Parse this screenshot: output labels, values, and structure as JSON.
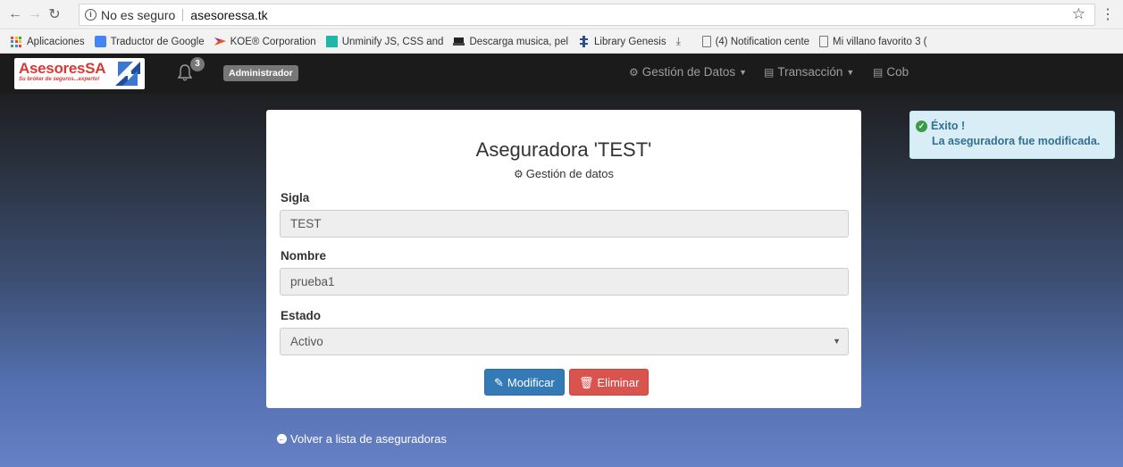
{
  "browser": {
    "security_label": "No es seguro",
    "url": "asesoressa.tk",
    "bookmarks": [
      {
        "label": "Aplicaciones",
        "icon": "apps-icon"
      },
      {
        "label": "Traductor de Google",
        "icon": "translate-icon"
      },
      {
        "label": "KOE® Corporation",
        "icon": "koe-icon"
      },
      {
        "label": "Unminify JS, CSS and",
        "icon": "unminify-icon"
      },
      {
        "label": "Descarga musica, pel",
        "icon": "download-site-icon"
      },
      {
        "label": "Library Genesis",
        "icon": "library-icon"
      },
      {
        "label": "",
        "icon": "download-icon"
      },
      {
        "label": "(4) Notification cente",
        "icon": "page-icon"
      },
      {
        "label": "Mi villano favorito 3 (",
        "icon": "page-icon"
      }
    ]
  },
  "navbar": {
    "brand": {
      "name": "AsesoresSA",
      "tagline": "Su bróker de seguros...experto!"
    },
    "notifications_count": "3",
    "role_badge": "Administrador",
    "menu": [
      {
        "label": "Gestión de Datos",
        "icon": "gear-icon"
      },
      {
        "label": "Transacción",
        "icon": "list-icon"
      },
      {
        "label": "Cob",
        "icon": "card-icon"
      }
    ]
  },
  "toast": {
    "title": "Éxito !",
    "message": "La aseguradora fue modificada.",
    "color": "#31708f"
  },
  "form": {
    "title": "Aseguradora 'TEST'",
    "subtitle": "Gestión de datos",
    "sigla_label": "Sigla",
    "sigla_value": "TEST",
    "nombre_label": "Nombre",
    "nombre_value": "prueba1",
    "estado_label": "Estado",
    "estado_value": "Activo",
    "modify_label": "Modificar",
    "delete_label": "Eliminar",
    "modify_color": "#337ab7",
    "delete_color": "#d9534f"
  },
  "back_link": "Volver a lista de aseguradoras"
}
